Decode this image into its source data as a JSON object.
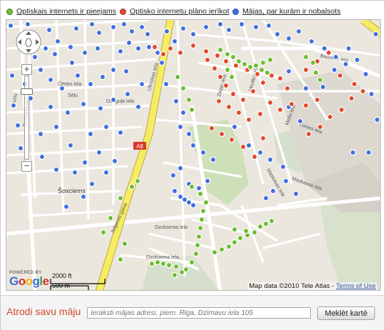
{
  "legend": {
    "items": [
      {
        "label": "Optiskais internets ir pieejams",
        "color": "#6dbd2f"
      },
      {
        "label": "Optisko internetu plāno ierīkot",
        "color": "#e34a2d"
      },
      {
        "label": "Mājas, par kurām ir nobalsots",
        "color": "#3f6fe0"
      }
    ]
  },
  "map": {
    "road_label_a8": "A8",
    "street_labels": [
      "Kalnciema iela",
      "Ulbrokas iela",
      "Čērtes iela",
      "Ozolciema iela",
      "Ikšķiles iela",
      "Dzelzava iela",
      "Ziepju iela",
      "Vecāķu iela",
      "Dauguļa iela",
      "Bauskas iela",
      "Tumes iela",
      "Mežu iela",
      "Višķu iela",
      "Līmbažu iela",
      "Maskavas iela",
      "Ozolciema iela",
      "Ozolciems",
      "Kurtu",
      "Sēļu"
    ],
    "area_labels": [
      "Šosciems"
    ],
    "highway_label": "Jelgavas gatve",
    "scale": {
      "feet": "2000 ft",
      "meters": "500 m"
    },
    "powered_by": "POWERED BY",
    "logo_text": "Google",
    "credit": "Map data ©2010 Tele Atlas",
    "terms": "Terms of Use"
  },
  "search": {
    "title": "Atrodi savu māju",
    "placeholder": "Ieraksti mājas adresi, piem. Rīga, Dzirnavu iela 105",
    "value": "",
    "button_label": "Meklēt kartē"
  }
}
